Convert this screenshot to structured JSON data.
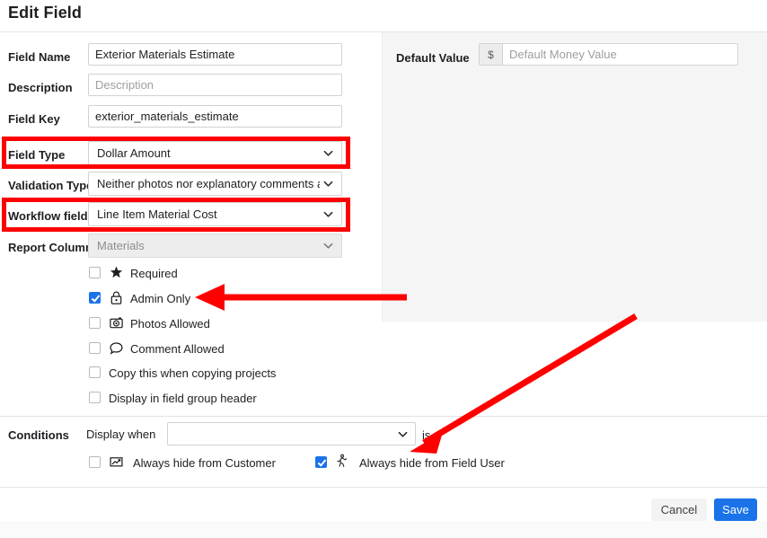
{
  "header": {
    "title": "Edit Field"
  },
  "form": {
    "rows": [
      {
        "label": "Field Name",
        "value": "Exterior Materials Estimate",
        "placeholder": "",
        "type": "text"
      },
      {
        "label": "Description",
        "value": "",
        "placeholder": "Description",
        "type": "text"
      },
      {
        "label": "Field Key",
        "value": "exterior_materials_estimate",
        "placeholder": "",
        "type": "text"
      },
      {
        "label": "Field Type",
        "value": "Dollar Amount",
        "type": "select"
      },
      {
        "label": "Validation Type",
        "value": "Neither photos nor explanatory comments are re",
        "type": "select"
      },
      {
        "label": "Workflow field",
        "value": "Line Item Material Cost",
        "type": "select"
      },
      {
        "label": "Report Column",
        "value": "Materials",
        "type": "select-disabled"
      }
    ]
  },
  "options": {
    "items": [
      {
        "label": "Required",
        "checked": false,
        "icon": "star-icon"
      },
      {
        "label": "Admin Only",
        "checked": true,
        "icon": "lock-icon"
      },
      {
        "label": "Photos Allowed",
        "checked": false,
        "icon": "camera-icon"
      },
      {
        "label": "Comment Allowed",
        "checked": false,
        "icon": "comment-icon"
      },
      {
        "label": "Copy this when copying projects",
        "checked": false,
        "icon": ""
      },
      {
        "label": "Display in field group header",
        "checked": false,
        "icon": ""
      }
    ]
  },
  "right_panel": {
    "default_value_label": "Default Value",
    "currency_symbol": "$",
    "default_value": "",
    "default_value_placeholder": "Default Money Value"
  },
  "conditions": {
    "section_label": "Conditions",
    "display_when_label": "Display when",
    "display_when_value": "",
    "is_label": "is",
    "hide_from_customer": {
      "label": "Always hide from Customer",
      "checked": false,
      "icon": "presentation-chart-icon"
    },
    "hide_from_field_user": {
      "label": "Always hide from Field User",
      "checked": true,
      "icon": "field-worker-icon"
    }
  },
  "footer": {
    "cancel_label": "Cancel",
    "save_label": "Save"
  },
  "colors": {
    "accent_blue": "#1a73e8",
    "annotation_red": "#fe0000",
    "panel_gray": "#f5f5f5",
    "disabled_gray": "#ededed"
  }
}
